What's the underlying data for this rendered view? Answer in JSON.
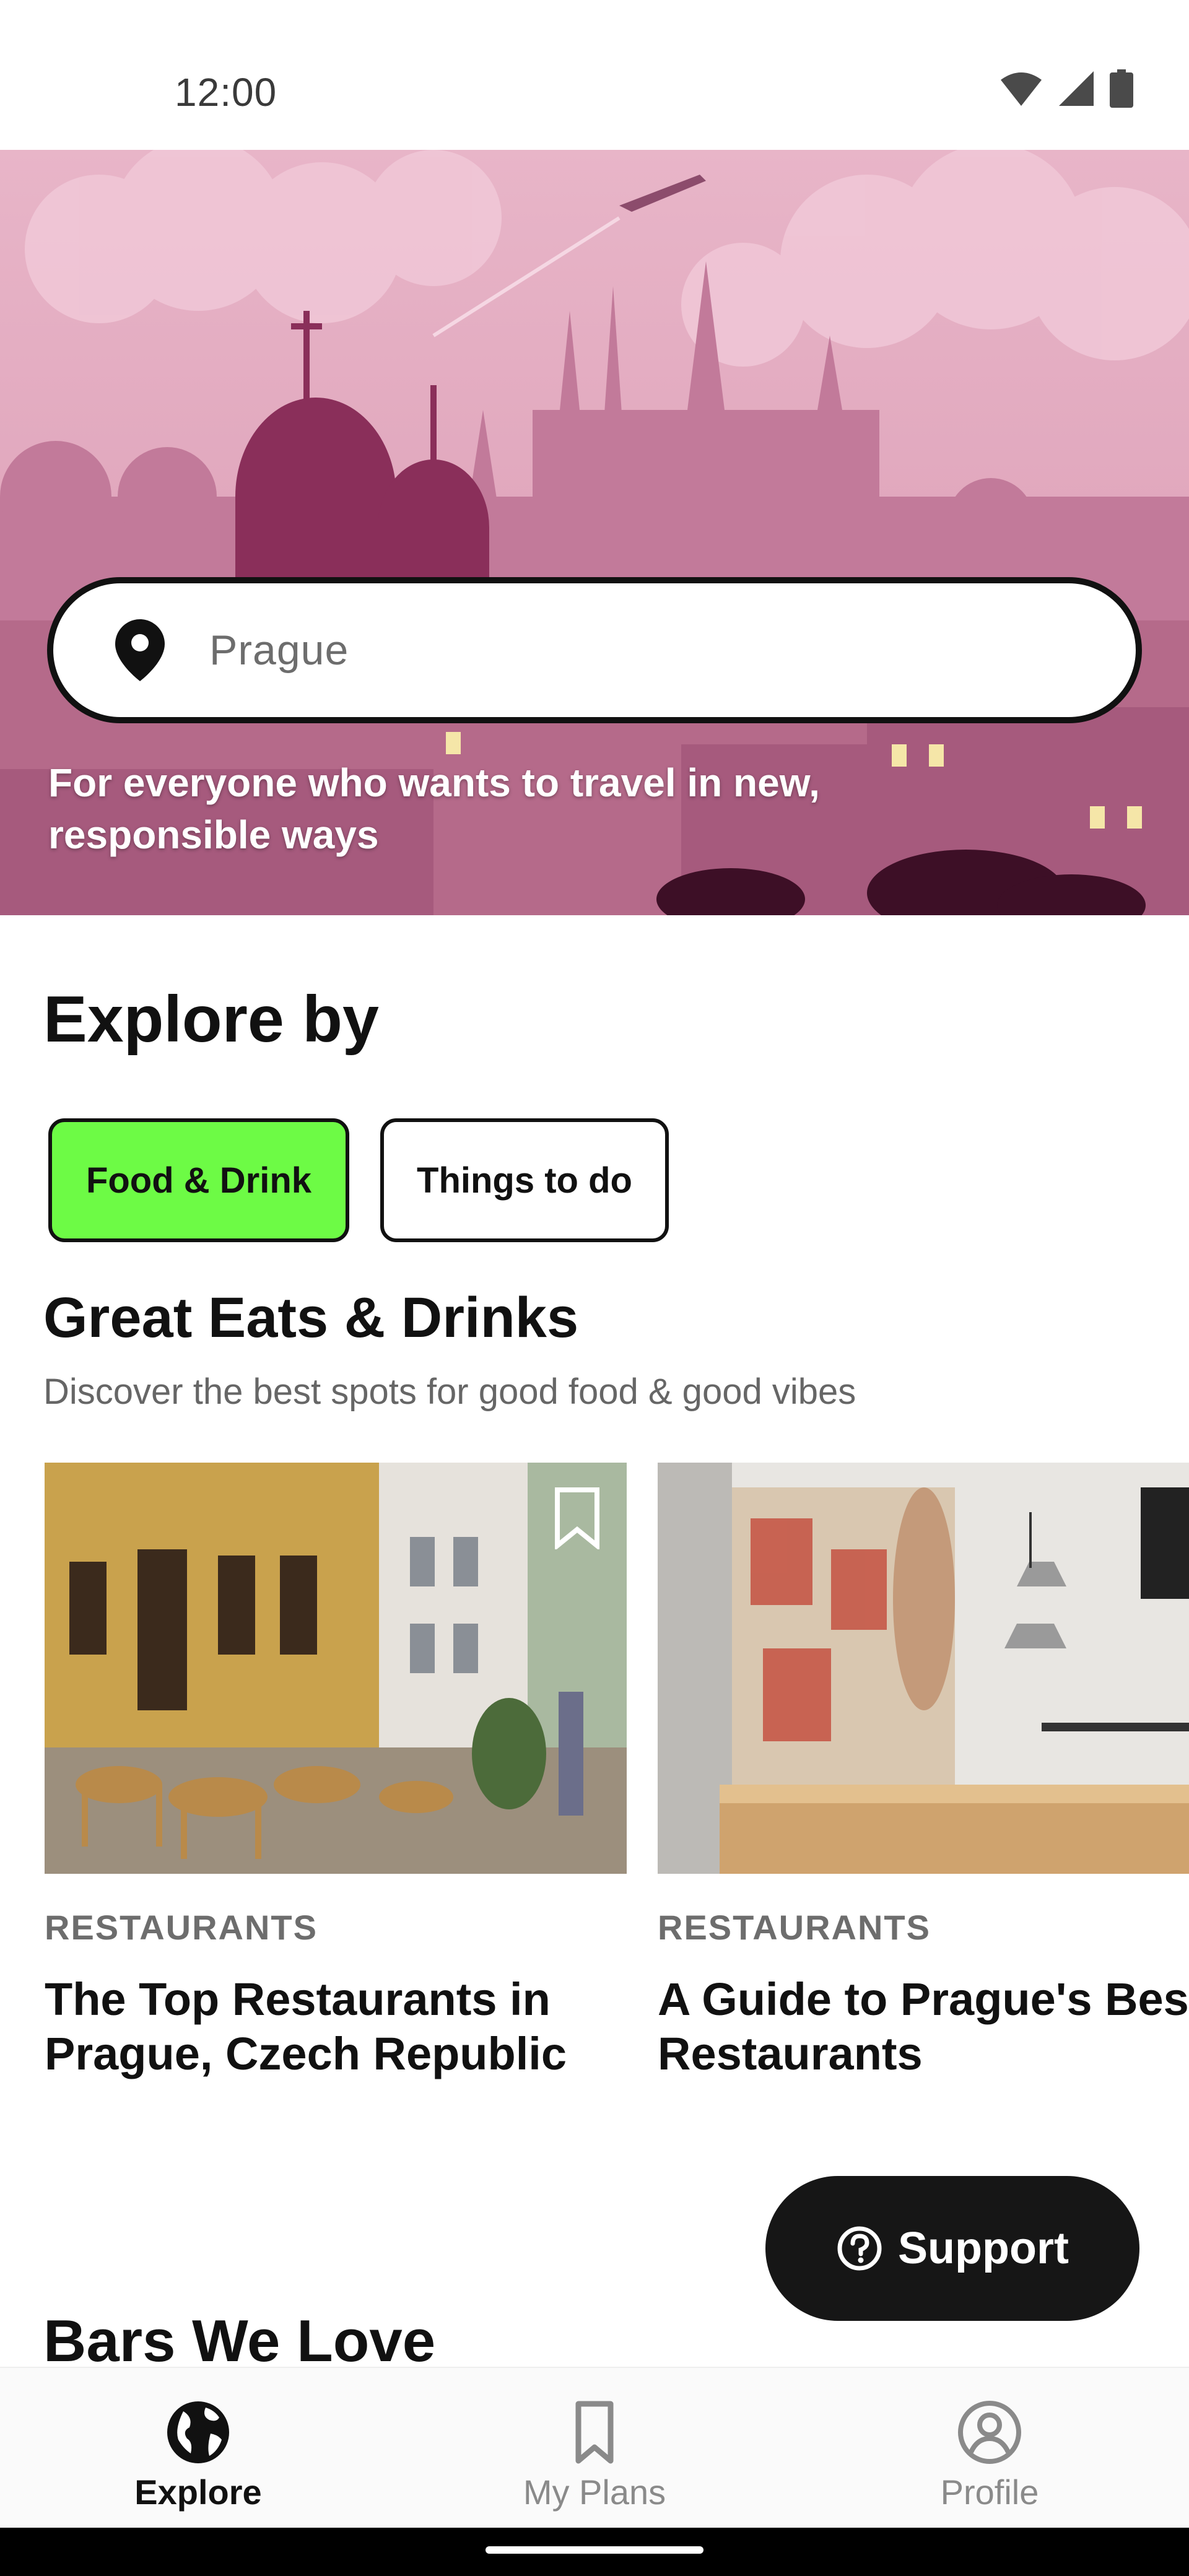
{
  "status_bar": {
    "time": "12:00",
    "icons": [
      "wifi-icon",
      "signal-icon",
      "battery-icon"
    ]
  },
  "hero": {
    "search_value": "Prague",
    "tagline": "For everyone who wants to travel in new, responsible ways"
  },
  "explore": {
    "title": "Explore by",
    "chips": [
      {
        "label": "Food & Drink",
        "selected": true
      },
      {
        "label": "Things to do",
        "selected": false
      }
    ]
  },
  "eats": {
    "title": "Great Eats & Drinks",
    "subtitle": "Discover the best spots for good food & good vibes",
    "cards": [
      {
        "category": "RESTAURANTS",
        "title": "The Top Restaurants in Prague, Czech Republic"
      },
      {
        "category": "RESTAURANTS",
        "title": "A Guide to Prague's Best Restaurants"
      }
    ]
  },
  "support": {
    "label": "Support"
  },
  "bars": {
    "title": "Bars We Love"
  },
  "bottom_nav": {
    "items": [
      {
        "label": "Explore",
        "icon": "globe-icon",
        "active": true
      },
      {
        "label": "My Plans",
        "icon": "bookmark-icon",
        "active": false
      },
      {
        "label": "Profile",
        "icon": "profile-icon",
        "active": false
      }
    ]
  },
  "colors": {
    "accent_chip": "#6dfb45",
    "hero_pink": "#e7b3c6",
    "support_bg": "#161616"
  }
}
